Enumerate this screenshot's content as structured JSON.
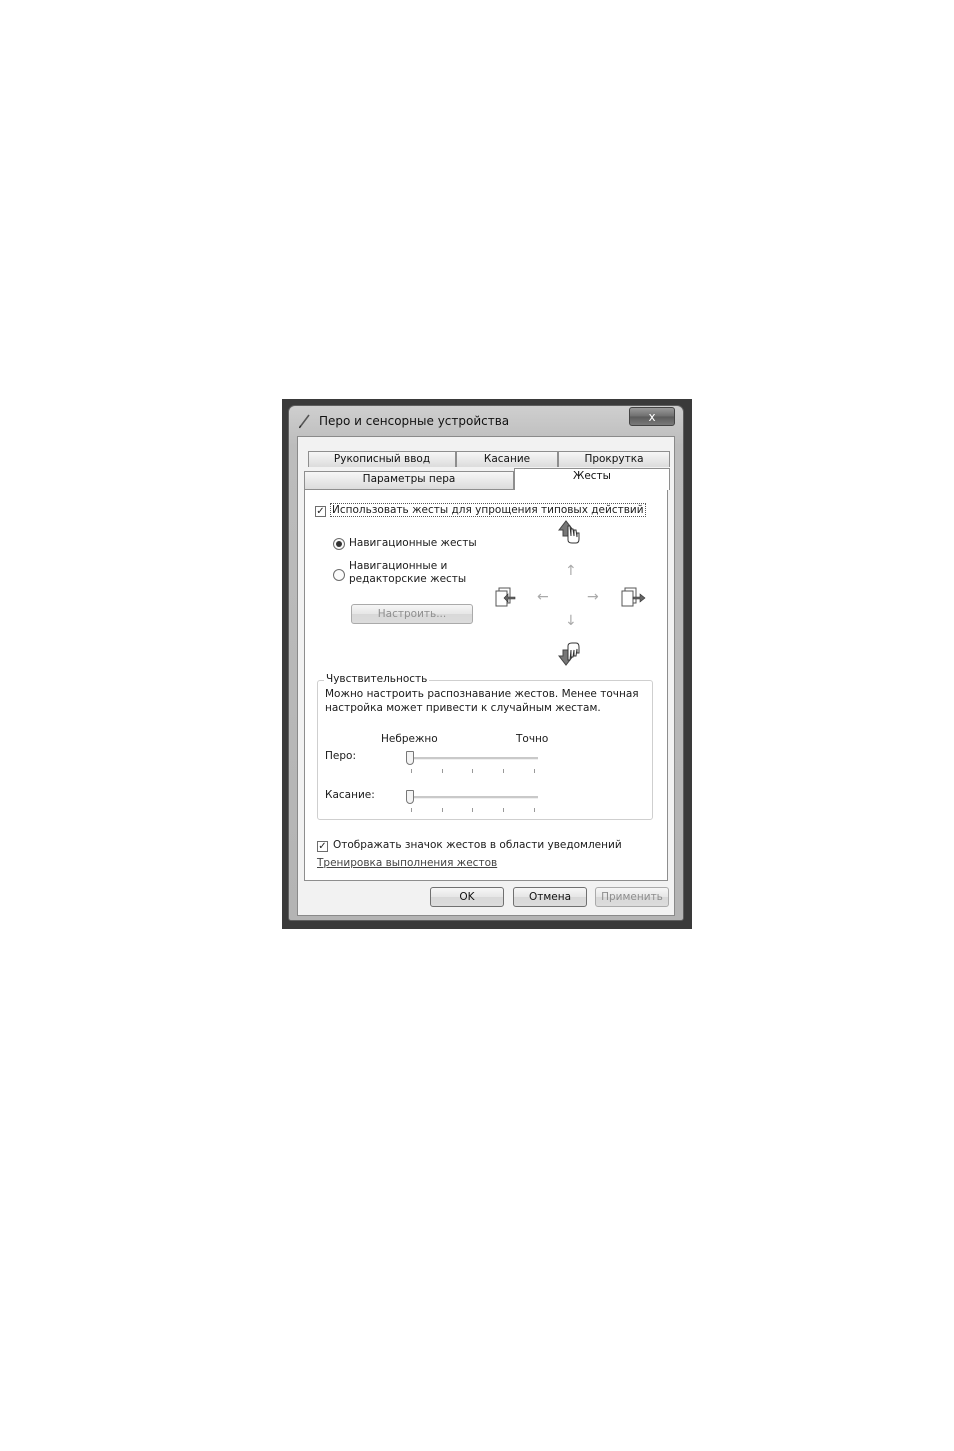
{
  "window": {
    "title": "Перо и сенсорные устройства",
    "close_label": "x"
  },
  "tabs": {
    "row1": [
      "Рукописный ввод",
      "Касание",
      "Прокрутка"
    ],
    "row2": [
      "Параметры пера",
      "Жесты"
    ],
    "active": "Жесты"
  },
  "gestures": {
    "use_gestures_label": "Использовать жесты для упрощения типовых действий",
    "use_gestures_checked": true,
    "radio_nav_label": "Навигационные жесты",
    "radio_nav_edit_label1": "Навигационные и",
    "radio_nav_edit_label2": "редакторские жесты",
    "selected_radio": "nav",
    "customize_button": "Настроить..."
  },
  "sensitivity": {
    "title": "Чувствительность",
    "description1": "Можно настроить распознавание жестов. Менее точная",
    "description2": "настройка может привести к случайным жестам.",
    "scale_left": "Небрежно",
    "scale_right": "Точно",
    "pen_label": "Перо:",
    "touch_label": "Касание:",
    "pen_value": 0,
    "touch_value": 0
  },
  "notify": {
    "label": "Отображать значок жестов в области уведомлений",
    "checked": true
  },
  "training_link": "Тренировка выполнения жестов",
  "buttons": {
    "ok": "OK",
    "cancel": "Отмена",
    "apply": "Применить"
  },
  "glyphs": {
    "check": "✓",
    "arrow_up": "↑",
    "arrow_down": "↓",
    "arrow_left": "←",
    "arrow_right": "→"
  }
}
